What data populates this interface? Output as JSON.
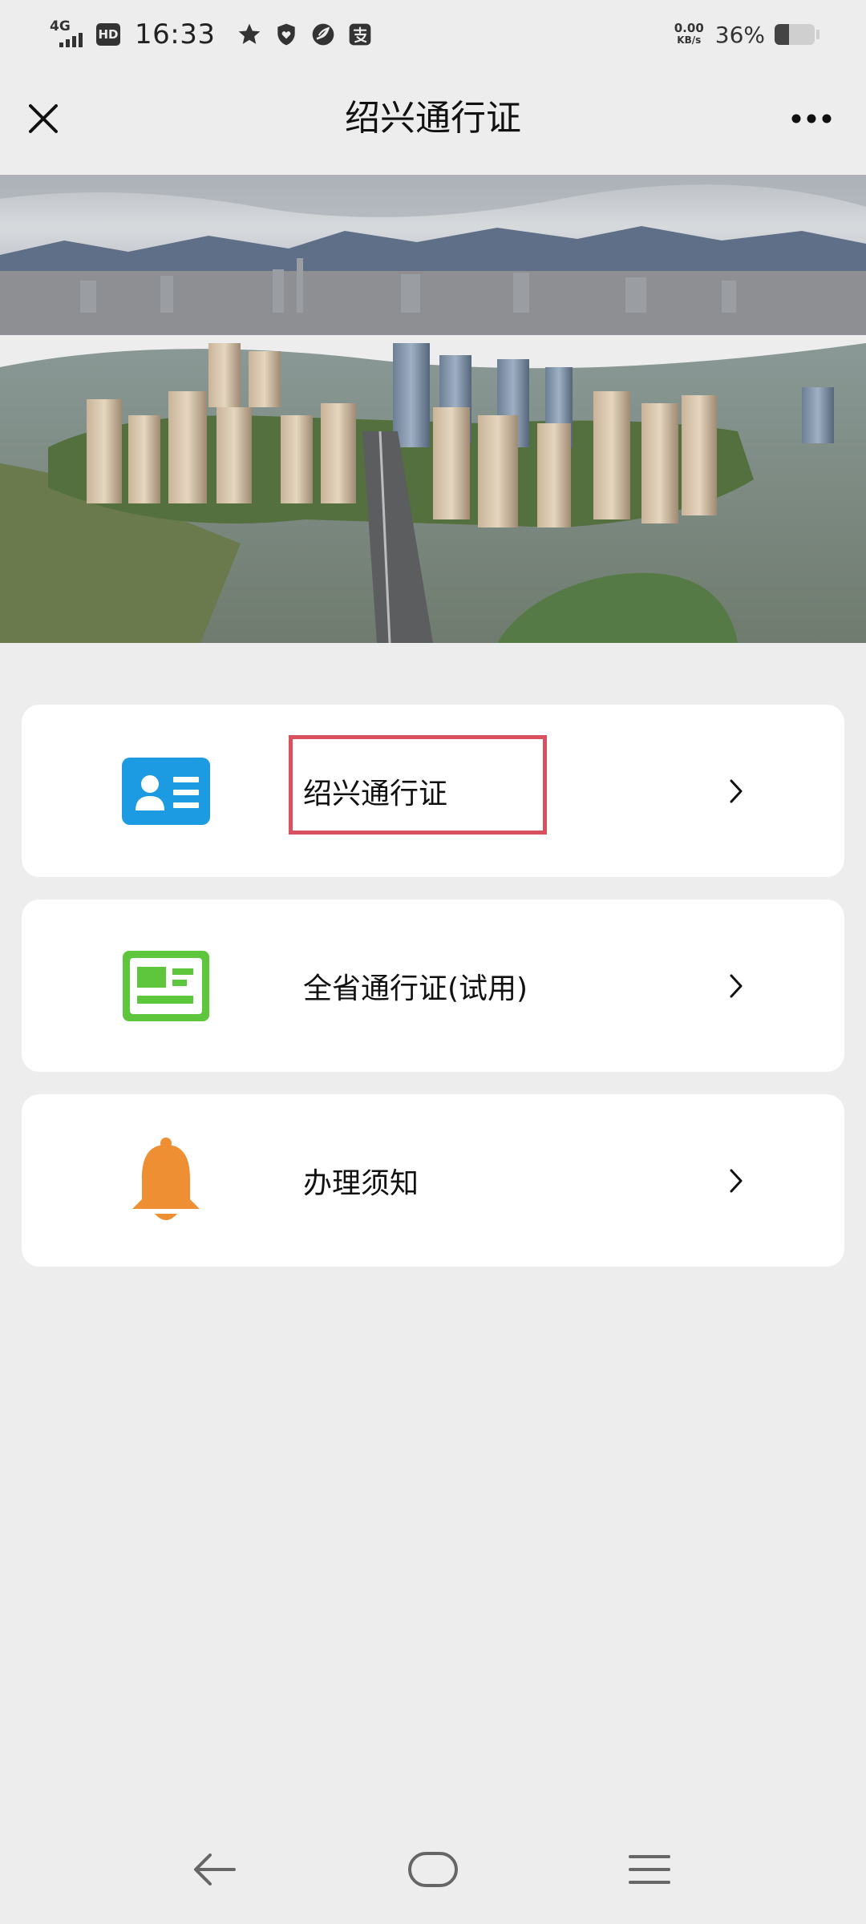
{
  "status_bar": {
    "network": "4G",
    "hd": "HD",
    "time": "16:33",
    "notification_icons": [
      "star-icon",
      "shield-heart-icon",
      "leaf-icon",
      "pay-icon"
    ],
    "net_speed_value": "0.00",
    "net_speed_unit": "KB/s",
    "battery_percent": "36%",
    "battery_level": 0.36
  },
  "nav": {
    "title": "绍兴通行证",
    "close_icon": "close-icon",
    "more_icon": "more-icon"
  },
  "banner": {
    "description_icon": "city-aerial-photo"
  },
  "menu": {
    "items": [
      {
        "label": "绍兴通行证",
        "icon": "id-card-icon",
        "icon_color": "#1c9ae2",
        "highlighted": true
      },
      {
        "label": "全省通行证(试用)",
        "icon": "license-card-icon",
        "icon_color": "#5ec63c",
        "highlighted": false
      },
      {
        "label": "办理须知",
        "icon": "bell-icon",
        "icon_color": "#ee8f33",
        "highlighted": false
      }
    ]
  },
  "colors": {
    "background": "#ededed",
    "card": "#ffffff",
    "highlight_border": "#d9505e"
  },
  "system_nav": {
    "back_icon": "back-arrow-icon",
    "home_icon": "home-icon",
    "menu_icon": "hamburger-icon"
  }
}
